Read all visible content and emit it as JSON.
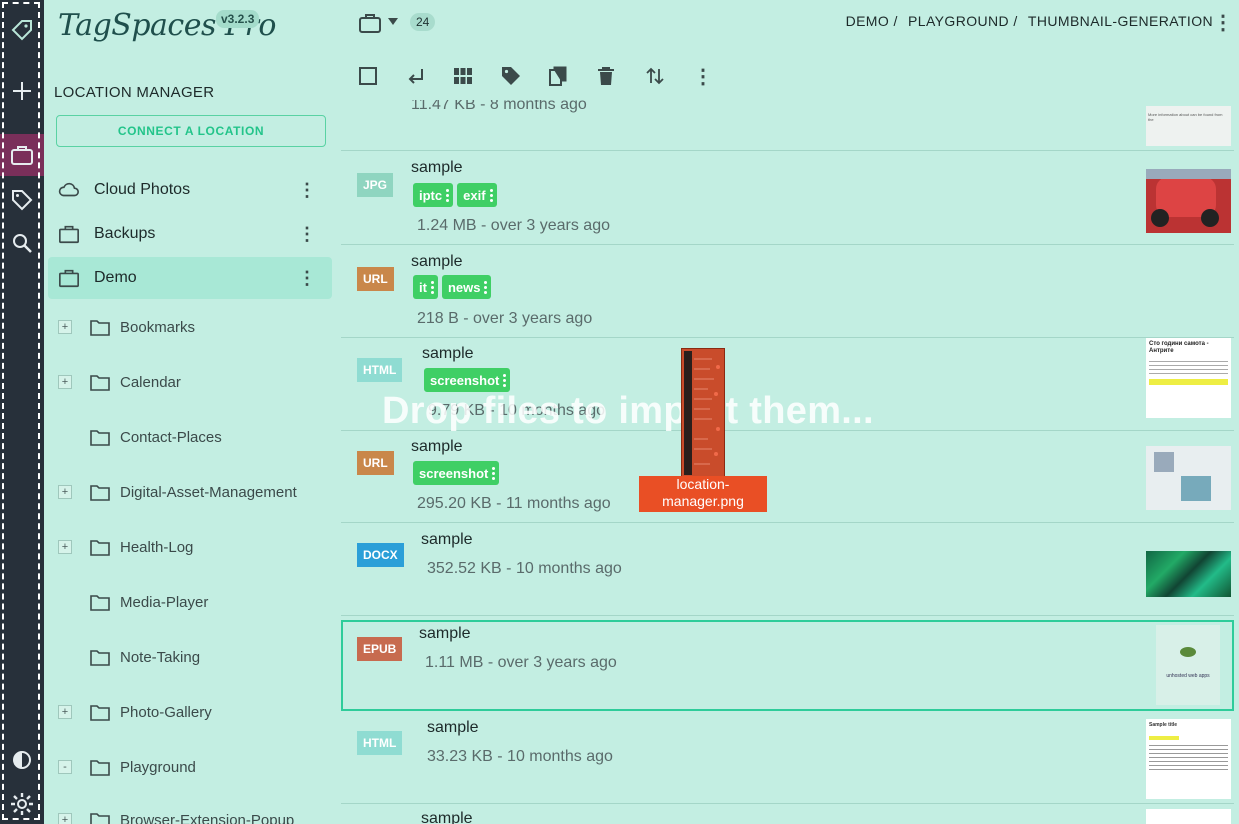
{
  "app": {
    "name": "TagSpaces Pro",
    "version": "v3.2.3"
  },
  "panel": {
    "title": "LOCATION MANAGER",
    "connect_label": "CONNECT A LOCATION",
    "locations": [
      {
        "name": "Cloud Photos",
        "icon": "cloud-icon"
      },
      {
        "name": "Backups",
        "icon": "briefcase-icon"
      },
      {
        "name": "Demo",
        "icon": "briefcase-icon",
        "selected": true
      }
    ],
    "folders": [
      {
        "name": "Bookmarks",
        "expand": "+"
      },
      {
        "name": "Calendar",
        "expand": "+"
      },
      {
        "name": "Contact-Places",
        "expand": ""
      },
      {
        "name": "Digital-Asset-Management",
        "expand": "+"
      },
      {
        "name": "Health-Log",
        "expand": "+"
      },
      {
        "name": "Media-Player",
        "expand": ""
      },
      {
        "name": "Note-Taking",
        "expand": ""
      },
      {
        "name": "Photo-Gallery",
        "expand": "+"
      },
      {
        "name": "Playground",
        "expand": "-"
      },
      {
        "name": "Browser-Extension-Popup",
        "expand": "+"
      }
    ]
  },
  "main": {
    "count": "24",
    "breadcrumb": [
      "DEMO /",
      "PLAYGROUND /",
      "THUMBNAIL-GENERATION"
    ],
    "partial_meta": "11.47 KB - 8 months ago",
    "files": [
      {
        "ext": "JPG",
        "ext_color": "#8fd5c0",
        "name": "sample",
        "tags": [
          "iptc",
          "exif"
        ],
        "meta": "1.24 MB - over 3 years ago"
      },
      {
        "ext": "URL",
        "ext_color": "#c9874a",
        "name": "sample",
        "tags": [
          "it",
          "news"
        ],
        "meta": "218 B - over 3 years ago"
      },
      {
        "ext": "HTML",
        "ext_color": "#8fdcd2",
        "name": "sample",
        "tags": [
          "screenshot"
        ],
        "meta": "9.79 KB - 10 months ago"
      },
      {
        "ext": "URL",
        "ext_color": "#c9874a",
        "name": "sample",
        "tags": [
          "screenshot"
        ],
        "meta": "295.20 KB - 11 months ago"
      },
      {
        "ext": "DOCX",
        "ext_color": "#2b9fd8",
        "name": "sample",
        "tags": [],
        "meta": "352.52 KB - 10 months ago"
      },
      {
        "ext": "EPUB",
        "ext_color": "#c76b4f",
        "name": "sample",
        "tags": [],
        "meta": "1.11 MB - over 3 years ago"
      },
      {
        "ext": "HTML",
        "ext_color": "#8fdcd2",
        "name": "sample",
        "tags": [],
        "meta": "33.23 KB - 10 months ago"
      },
      {
        "ext": "",
        "ext_color": "#8fdcd2",
        "name": "sample",
        "tags": [],
        "meta": ""
      }
    ]
  },
  "overlay": {
    "drop_text": "Drop files to import them...",
    "drag_label": "location-manager.png"
  },
  "thumbs": {
    "epub_text": "unhosted web apps",
    "html_title": "Сто години самота - Антрите",
    "html2_title": "Sample title"
  }
}
